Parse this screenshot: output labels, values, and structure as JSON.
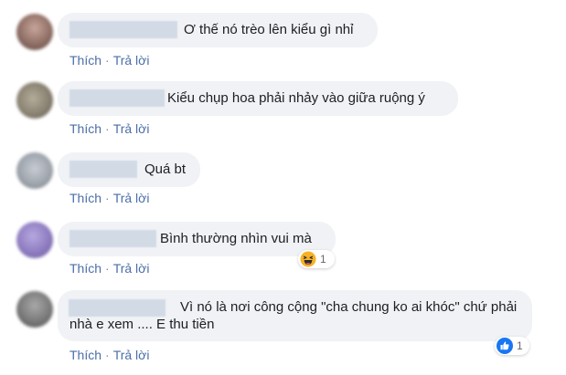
{
  "comments": [
    {
      "text": "Ơ thế nó trèo lên kiểu gì nhỉ",
      "like_label": "Thích",
      "reply_label": "Trả lời",
      "avatar_color": "#9a7e73"
    },
    {
      "text": "Kiểu chụp hoa phải nhảy vào giữa ruộng ý",
      "like_label": "Thích",
      "reply_label": "Trả lời",
      "avatar_color": "#8a8578"
    },
    {
      "text": "Quá bt",
      "like_label": "Thích",
      "reply_label": "Trả lời",
      "avatar_color": "#9aa0a8"
    },
    {
      "text": "Bình thường nhìn vui mà",
      "like_label": "Thích",
      "reply_label": "Trả lời",
      "avatar_color": "#8a7ab8",
      "reaction": {
        "icon": "haha-emoji-icon",
        "count": "1"
      }
    },
    {
      "text": "Vì nó là nơi công cộng \"cha chung ko ai khóc\" chứ phải nhà e xem .... E thu tiền",
      "like_label": "Thích",
      "reply_label": "Trả lời",
      "avatar_color": "#7c7c7c",
      "reaction": {
        "icon": "like-thumb-icon",
        "count": "1"
      }
    }
  ]
}
